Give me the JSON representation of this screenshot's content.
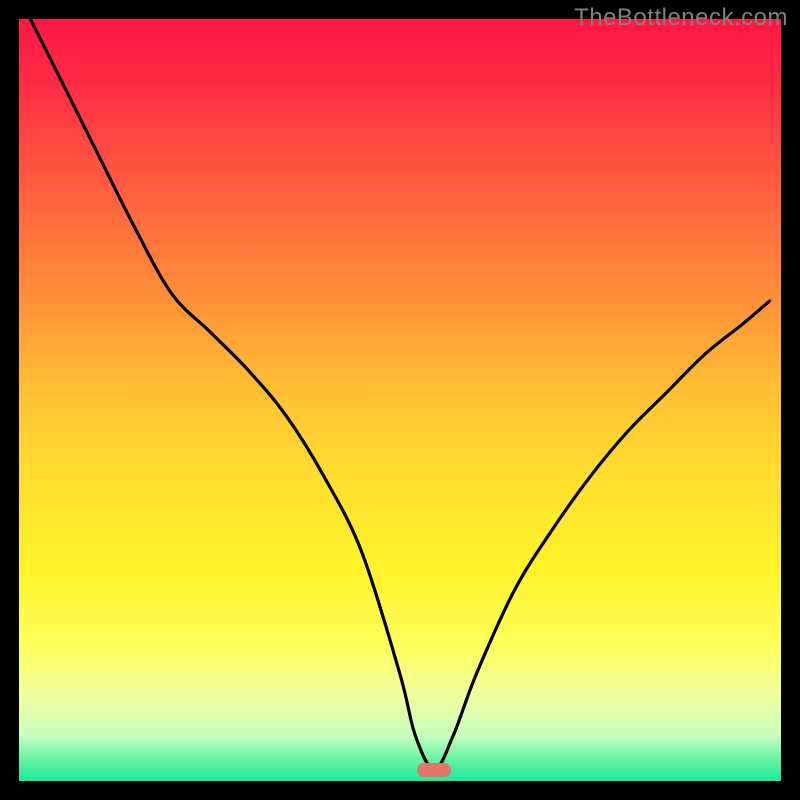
{
  "watermark": "TheBottleneck.com",
  "gradient_stops": [
    {
      "offset": 0.0,
      "color": "#ff1744"
    },
    {
      "offset": 0.08,
      "color": "#ff2a45"
    },
    {
      "offset": 0.2,
      "color": "#ff5640"
    },
    {
      "offset": 0.35,
      "color": "#ff8a3a"
    },
    {
      "offset": 0.5,
      "color": "#ffc433"
    },
    {
      "offset": 0.62,
      "color": "#ffe22e"
    },
    {
      "offset": 0.72,
      "color": "#fff22b"
    },
    {
      "offset": 0.82,
      "color": "#fdff5a"
    },
    {
      "offset": 0.89,
      "color": "#f1ffa0"
    },
    {
      "offset": 0.94,
      "color": "#c8ffbe"
    },
    {
      "offset": 0.975,
      "color": "#5cf2a0"
    },
    {
      "offset": 1.0,
      "color": "#1de9a0"
    }
  ],
  "marker": {
    "x_frac": 0.545,
    "y_frac": 0.985,
    "color": "#e1776b"
  },
  "chart_data": {
    "type": "line",
    "title": "",
    "xlabel": "",
    "ylabel": "",
    "xlim": [
      0,
      1
    ],
    "ylim": [
      0,
      1
    ],
    "series": [
      {
        "name": "curve",
        "x": [
          0.015,
          0.05,
          0.1,
          0.15,
          0.2,
          0.25,
          0.3,
          0.35,
          0.4,
          0.45,
          0.5,
          0.52,
          0.545,
          0.57,
          0.6,
          0.65,
          0.7,
          0.75,
          0.8,
          0.85,
          0.9,
          0.95,
          0.985
        ],
        "y": [
          1.0,
          0.93,
          0.83,
          0.73,
          0.64,
          0.59,
          0.54,
          0.48,
          0.4,
          0.3,
          0.14,
          0.06,
          0.015,
          0.06,
          0.14,
          0.25,
          0.33,
          0.4,
          0.46,
          0.51,
          0.56,
          0.6,
          0.63
        ]
      }
    ],
    "annotations": [
      {
        "name": "marker",
        "x": 0.545,
        "y": 0.015,
        "color": "#e1776b"
      }
    ]
  }
}
